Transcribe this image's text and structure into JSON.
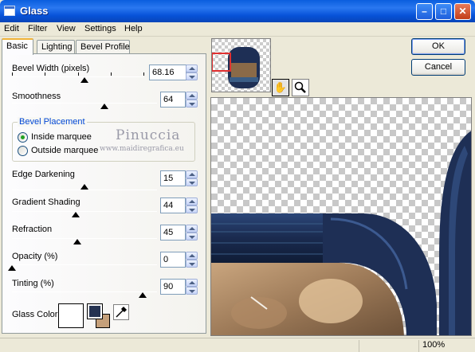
{
  "window": {
    "title": "Glass"
  },
  "menu": [
    "Edit",
    "Filter",
    "View",
    "Settings",
    "Help"
  ],
  "tabs": [
    "Basic",
    "Lighting",
    "Bevel Profile"
  ],
  "controls": {
    "bevel_width": {
      "label": "Bevel Width (pixels)",
      "value": "68.16",
      "level": 0.55
    },
    "smoothness": {
      "label": "Smoothness",
      "value": "64",
      "level": 0.64
    },
    "edge_darkening": {
      "label": "Edge Darkening",
      "value": "15",
      "level": 0.5
    },
    "gradient_shading": {
      "label": "Gradient Shading",
      "value": "44",
      "level": 0.44
    },
    "refraction": {
      "label": "Refraction",
      "value": "45",
      "level": 0.45
    },
    "opacity": {
      "label": "Opacity (%)",
      "value": "0",
      "level": 0.0
    },
    "tinting": {
      "label": "Tinting (%)",
      "value": "90",
      "level": 0.9
    }
  },
  "bevel_placement": {
    "title": "Bevel Placement",
    "inside": "Inside marquee",
    "outside": "Outside marquee"
  },
  "glass_color": {
    "label": "Glass Color",
    "fg": "#ffffff",
    "color1": "#253352",
    "color2": "#c5a07a"
  },
  "watermark": {
    "line1": "Pinuccia",
    "line2": "www.maidiregrafica.eu"
  },
  "buttons": {
    "ok": "OK",
    "cancel": "Cancel"
  },
  "status": {
    "zoom": "100%"
  },
  "colors": {
    "titlebar": "#0a5ede",
    "accent_tab": "#f0b33a",
    "frame_blue": "#1e2f55"
  }
}
